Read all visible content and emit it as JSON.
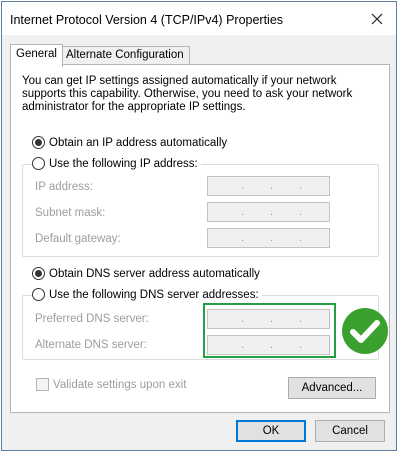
{
  "window": {
    "title": "Internet Protocol Version 4 (TCP/IPv4) Properties"
  },
  "tabs": [
    {
      "label": "General",
      "active": true
    },
    {
      "label": "Alternate Configuration",
      "active": false
    }
  ],
  "intro_text": "You can get IP settings assigned automatically if your network supports this capability. Otherwise, you need to ask your network administrator for the appropriate IP settings.",
  "ip_section": {
    "auto_label": "Obtain an IP address automatically",
    "auto_selected": true,
    "manual_label": "Use the following IP address:",
    "fields": [
      {
        "label": "IP address:",
        "value": ". . ."
      },
      {
        "label": "Subnet mask:",
        "value": ". . ."
      },
      {
        "label": "Default gateway:",
        "value": ". . ."
      }
    ]
  },
  "dns_section": {
    "auto_label": "Obtain DNS server address automatically",
    "auto_selected": true,
    "manual_label": "Use the following DNS server addresses:",
    "fields": [
      {
        "label": "Preferred DNS server:",
        "value": ". . ."
      },
      {
        "label": "Alternate DNS server:",
        "value": ". . ."
      }
    ]
  },
  "validate_label": "Validate settings upon exit",
  "buttons": {
    "advanced": "Advanced...",
    "ok": "OK",
    "cancel": "Cancel"
  },
  "colors": {
    "highlight_border": "#22a046",
    "check_badge": "#3aa02e",
    "accent": "#0078d7"
  },
  "icons": [
    "close-icon",
    "checkmark-badge-icon"
  ]
}
